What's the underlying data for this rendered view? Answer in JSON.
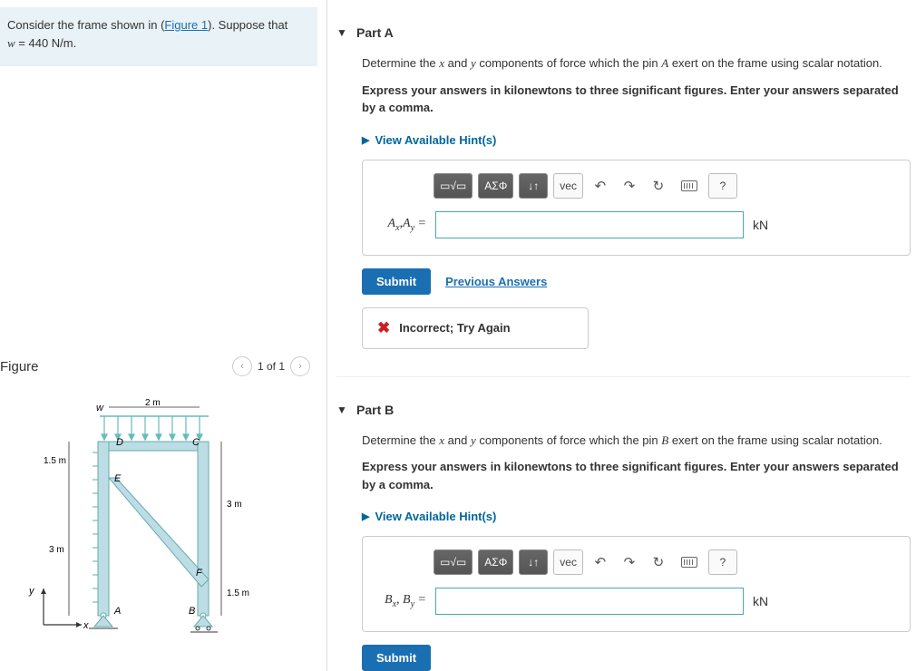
{
  "problem": {
    "intro_pre": "Consider the frame shown in (",
    "figure_link": "Figure 1",
    "intro_post": "). Suppose that",
    "var": "w",
    "eq": " = 440 ",
    "unit": "N/m",
    "period": "."
  },
  "figure": {
    "title": "Figure",
    "counter": "1 of 1",
    "labels": {
      "w": "w",
      "D": "D",
      "C": "C",
      "E": "E",
      "F": "F",
      "A": "A",
      "B": "B",
      "x": "x",
      "y": "y",
      "dim_2m": "2 m",
      "dim_15m_top": "1.5 m",
      "dim_3m_left": "3 m",
      "dim_3m_right": "3 m",
      "dim_15m_bot": "1.5 m"
    }
  },
  "parts": {
    "a": {
      "title": "Part A",
      "q_pre": "Determine the ",
      "q_x": "x",
      "q_and": " and ",
      "q_y": "y",
      "q_mid": " components of force which the pin ",
      "q_pin": "A",
      "q_post": " exert on the frame using scalar notation.",
      "instr": "Express your answers in kilonewtons to three significant figures. Enter your answers separated by a comma.",
      "hints": "View Available Hint(s)",
      "var_html": "A_x, A_y =",
      "unit": "kN",
      "submit": "Submit",
      "prev": "Previous Answers",
      "feedback": "Incorrect; Try Again"
    },
    "b": {
      "title": "Part B",
      "q_pre": "Determine the ",
      "q_x": "x",
      "q_and": " and ",
      "q_y": "y",
      "q_mid": " components of force which the pin ",
      "q_pin": "B",
      "q_post": " exert on the frame using scalar notation.",
      "instr": "Express your answers in kilonewtons to three significant figures. Enter your answers separated by a comma.",
      "hints": "View Available Hint(s)",
      "var_html": "B_x, B_y =",
      "unit": "kN",
      "submit": "Submit"
    }
  },
  "toolbar": {
    "templates": "▭√▭",
    "greek": "ΑΣΦ",
    "arrows": "↓↑",
    "vec": "vec",
    "undo": "↶",
    "redo": "↷",
    "reset": "↻",
    "help": "?"
  }
}
